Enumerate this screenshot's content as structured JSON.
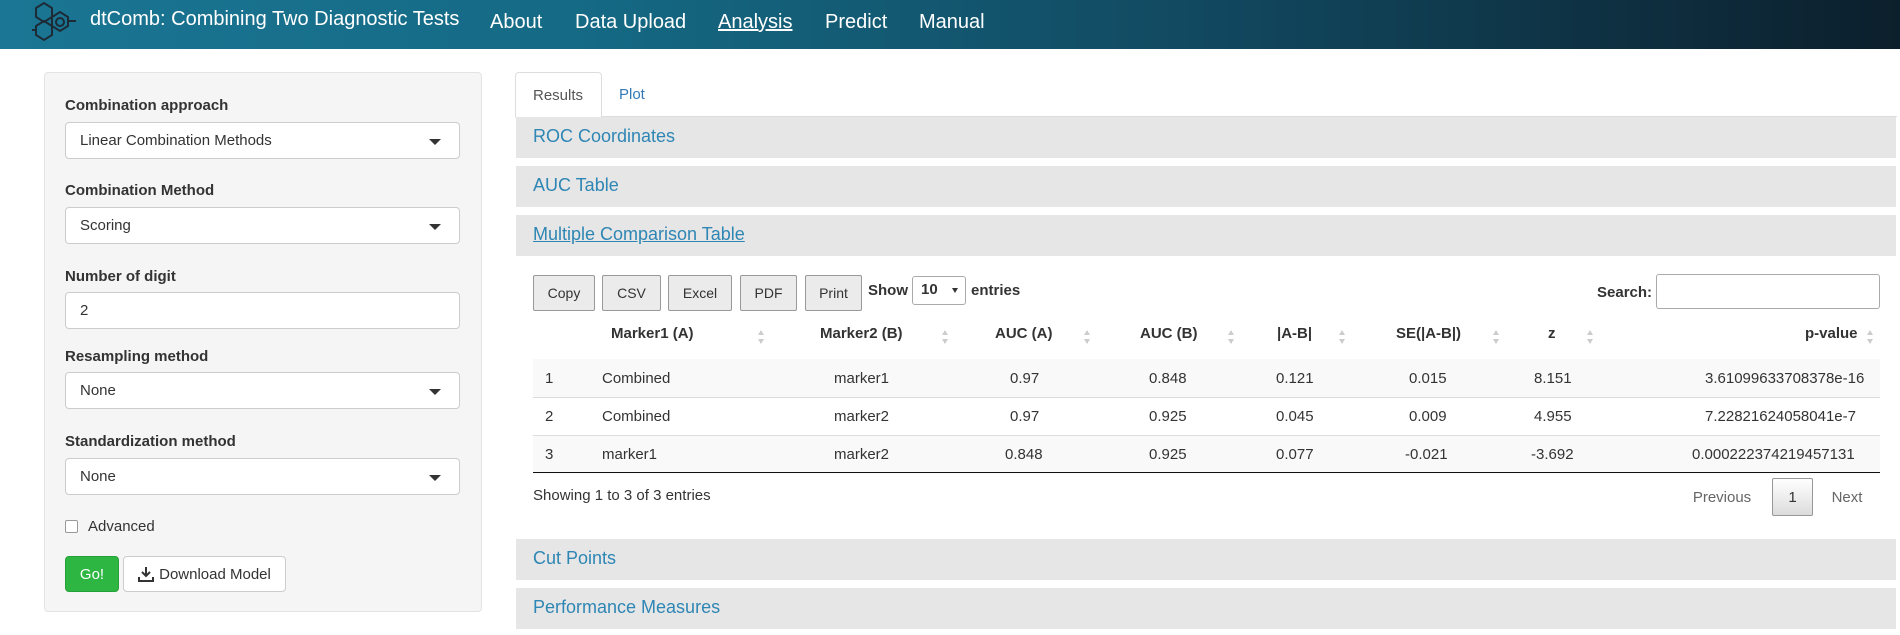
{
  "navbar": {
    "brand": "dtComb: Combining Two Diagnostic Tests",
    "links": [
      "About",
      "Data Upload",
      "Analysis",
      "Predict",
      "Manual"
    ],
    "active": "Analysis"
  },
  "sidebar": {
    "combination_approach": {
      "label": "Combination approach",
      "value": "Linear Combination Methods"
    },
    "combination_method": {
      "label": "Combination Method",
      "value": "Scoring"
    },
    "number_of_digit": {
      "label": "Number of digit",
      "value": "2"
    },
    "resampling_method": {
      "label": "Resampling method",
      "value": "None"
    },
    "standardization_method": {
      "label": "Standardization method",
      "value": "None"
    },
    "advanced": {
      "label": "Advanced",
      "checked": false
    },
    "go_label": "Go!",
    "download_label": "Download Model"
  },
  "tabs": [
    {
      "label": "Results",
      "active": true
    },
    {
      "label": "Plot",
      "active": false
    }
  ],
  "panels": {
    "roc": "ROC Coordinates",
    "auc": "AUC Table",
    "multiple": "Multiple Comparison Table",
    "cut": "Cut Points",
    "performance": "Performance Measures"
  },
  "datatable": {
    "buttons": [
      "Copy",
      "CSV",
      "Excel",
      "PDF",
      "Print"
    ],
    "show_label": "Show",
    "page_length": "10",
    "entries_label": "entries",
    "search_label": "Search:",
    "columns": [
      "Marker1 (A)",
      "Marker2 (B)",
      "AUC (A)",
      "AUC (B)",
      "|A-B|",
      "SE(|A-B|)",
      "z",
      "p-value"
    ],
    "rows": [
      [
        "1",
        "Combined",
        "marker1",
        "0.97",
        "0.848",
        "0.121",
        "0.015",
        "8.151",
        "3.61099633708378e-16"
      ],
      [
        "2",
        "Combined",
        "marker2",
        "0.97",
        "0.925",
        "0.045",
        "0.009",
        "4.955",
        "7.22821624058041e-7"
      ],
      [
        "3",
        "marker1",
        "marker2",
        "0.848",
        "0.925",
        "0.077",
        "-0.021",
        "-3.692",
        "0.000222374219457131"
      ]
    ],
    "info": "Showing 1 to 3 of 3 entries",
    "pagination": {
      "previous": "Previous",
      "current": "1",
      "next": "Next"
    }
  },
  "colors": {
    "accent": "#2e86b4",
    "go_button": "#2db742",
    "navbar_start": "#1a7694",
    "navbar_end": "#0c1f2c"
  }
}
